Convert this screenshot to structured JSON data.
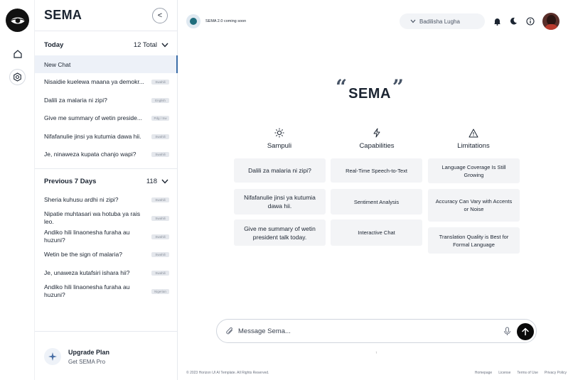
{
  "sidebar": {
    "brand": "SEMA",
    "collapse_label": "<",
    "today": {
      "title": "Today",
      "count": "12 Total",
      "new_chat": "New Chat",
      "items": [
        {
          "text": "Nisaidie kuelewa maana ya demokr...",
          "tag": "Swahili"
        },
        {
          "text": "Dalili za malaria ni zipi?",
          "tag": "English"
        },
        {
          "text": "Give me summary of wetin preside...",
          "tag": "Pdg / Sw"
        },
        {
          "text": "Nifafanulie jinsi ya kutumia dawa hii.",
          "tag": "Swahili"
        },
        {
          "text": "Je, ninaweza kupata chanjo wapi?",
          "tag": "Swahili"
        }
      ]
    },
    "previous": {
      "title": "Previous 7 Days",
      "count": "118",
      "items": [
        {
          "text": "Sheria kuhusu ardhi ni zipi?",
          "tag": "Swahili"
        },
        {
          "text": "Nipatie muhtasari wa hotuba ya rais leo.",
          "tag": "Swahili"
        },
        {
          "text": "Andiko hili linaonesha furaha au huzuni?",
          "tag": "Swahili"
        },
        {
          "text": "Wetin be the sign of malaria?",
          "tag": "Swahili"
        },
        {
          "text": "Je, unaweza kutafsiri ishara hii?",
          "tag": "Swahili"
        },
        {
          "text": "Andiko hili linaonesha furaha au huzuni?",
          "tag": "Nigerian"
        }
      ]
    },
    "upgrade": {
      "title": "Upgrade Plan",
      "subtitle": "Get SEMA Pro"
    }
  },
  "header": {
    "status": "SEMA 2.0 coming soon",
    "language": "Badilisha Lugha"
  },
  "hero": {
    "open_quote": "“",
    "name": "SEMA",
    "close_quote": "”"
  },
  "columns": {
    "sampuli": {
      "label": "Sampuli",
      "cards": [
        "Dalili za malaria ni zipi?",
        "Nifafanulie jinsi ya kutumia dawa hii.",
        "Give me summary of wetin president talk today."
      ]
    },
    "capabilities": {
      "label": "Capabilities",
      "cards": [
        "Real-Time Speech-to-Text",
        "Sentiment Analysis",
        "Interactive Chat"
      ]
    },
    "limitations": {
      "label": "Limitations",
      "cards": [
        "Language Coverage Is Still Growing",
        "Accuracy Can Vary with Accents or Noise",
        "Translation Quality is Best for Formal Language"
      ]
    }
  },
  "composer": {
    "placeholder": "Message Sema..."
  },
  "scroll_mark": "↑",
  "footer": {
    "copyright": "© 2023 Horizon UI AI Template. All Rights Reserved.",
    "links": [
      "Homepage",
      "License",
      "Terms of Use",
      "Privacy Policy"
    ]
  },
  "icons": {
    "logo": "eye-logo-icon",
    "home": "home-icon",
    "settings": "settings-icon",
    "bell": "bell-icon",
    "moon": "moon-icon",
    "info": "info-icon",
    "sun": "sun-icon",
    "bolt": "bolt-icon",
    "warning": "warning-icon",
    "attach": "paperclip-icon",
    "mic": "mic-icon",
    "send": "arrow-up-icon"
  },
  "colors": {
    "accent": "#3b6ea8",
    "active_bg": "#edf1f8",
    "card_bg": "#f3f4f6",
    "send_bg": "#0a0a0a"
  }
}
